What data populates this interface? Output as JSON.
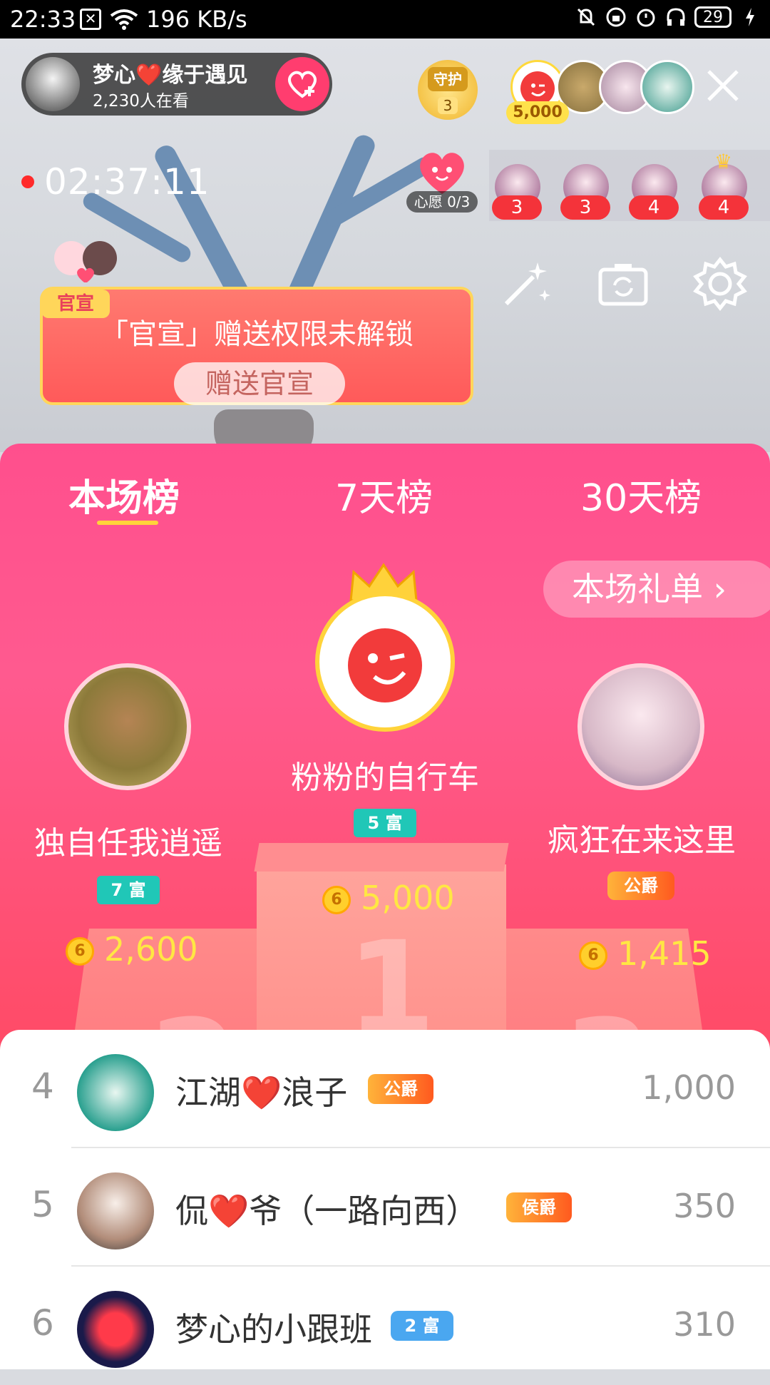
{
  "status_bar": {
    "time": "22:33",
    "net_speed": "196 KB/s",
    "battery": "29"
  },
  "live": {
    "host_name": "梦心❤️缘于遇见",
    "viewers": "2,230人在看",
    "guard_label": "守护",
    "guard_count": "3",
    "top_coin": "5,000",
    "timer": "02:37:11",
    "wish_label": "心愿 0/3",
    "fan_badges": [
      "3",
      "3",
      "4",
      "4"
    ],
    "banner_tag": "官宣",
    "banner_text": "「官宣」赠送权限未解锁",
    "banner_button": "赠送官宣"
  },
  "leaderboard": {
    "tabs": [
      "本场榜",
      "7天榜",
      "30天榜"
    ],
    "active_tab": 0,
    "gift_list_button": "本场礼单 ›",
    "podium": [
      {
        "rank": 2,
        "name": "独自任我逍遥",
        "badge": "7 富",
        "amount": "2,600"
      },
      {
        "rank": 1,
        "name": "粉粉的自行车",
        "badge": "5 富",
        "amount": "5,000"
      },
      {
        "rank": 3,
        "name": "疯狂在来这里",
        "badge": "公爵",
        "amount": "1,415"
      }
    ],
    "podium_numbers": [
      "2",
      "1",
      "3"
    ],
    "coin_glyph": "6",
    "list": [
      {
        "rank": "4",
        "name": "江湖❤️浪子",
        "badge": "公爵",
        "score": "1,000"
      },
      {
        "rank": "5",
        "name": "侃❤️爷（一路向西）",
        "badge": "侯爵",
        "score": "350"
      },
      {
        "rank": "6",
        "name": "梦心的小跟班",
        "badge": "2 富",
        "score": "310"
      }
    ]
  },
  "colors": {
    "panel_pink": "#ff4f8d",
    "accent_yellow": "#ffe743",
    "level_teal": "#20c7b7",
    "duke_orange": "#ff7a2a"
  }
}
